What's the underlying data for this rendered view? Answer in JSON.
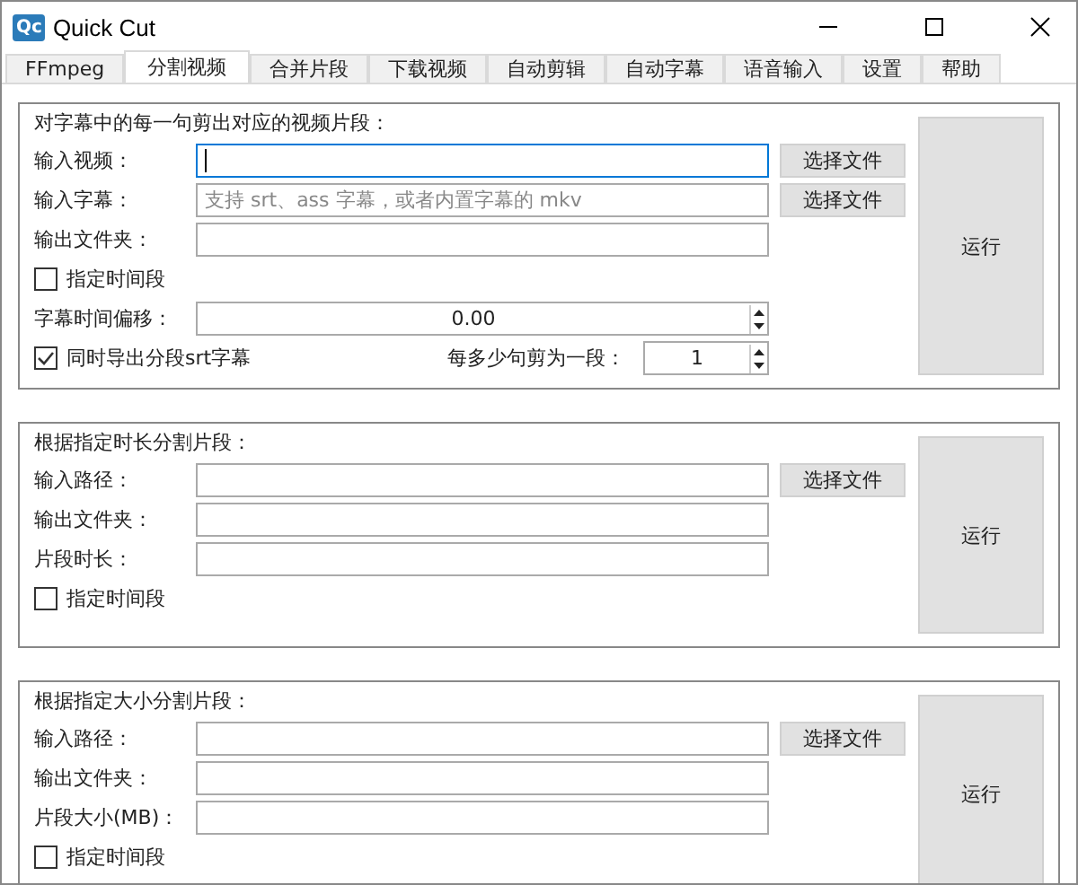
{
  "window": {
    "logo": "Qc",
    "title": "Quick Cut"
  },
  "tabs": [
    {
      "label": "FFmpeg",
      "selected": false
    },
    {
      "label": "分割视频",
      "selected": true
    },
    {
      "label": "合并片段",
      "selected": false
    },
    {
      "label": "下载视频",
      "selected": false
    },
    {
      "label": "自动剪辑",
      "selected": false
    },
    {
      "label": "自动字幕",
      "selected": false
    },
    {
      "label": "语音输入",
      "selected": false
    },
    {
      "label": "设置",
      "selected": false
    },
    {
      "label": "帮助",
      "selected": false
    }
  ],
  "sections": [
    {
      "title": "对字幕中的每一句剪出对应的视频片段：",
      "run_button": "运行",
      "rows": [
        {
          "kind": "field",
          "label": "输入视频：",
          "focused": true,
          "button": "选择文件"
        },
        {
          "kind": "field",
          "label": "输入字幕：",
          "placeholder": "支持 srt、ass 字幕，或者内置字幕的 mkv",
          "focused": false,
          "button": "选择文件"
        },
        {
          "kind": "field",
          "label": "输出文件夹：",
          "focused": false
        },
        {
          "kind": "checkbox",
          "label": "指定时间段",
          "checked": false
        },
        {
          "kind": "spin",
          "label": "字幕时间偏移：",
          "value": "0.00"
        },
        {
          "kind": "check_spin",
          "check_label": "同时导出分段srt字幕",
          "checked": true,
          "label": "每多少句剪为一段：",
          "value": "1"
        }
      ]
    },
    {
      "title": "根据指定时长分割片段：",
      "run_button": "运行",
      "rows": [
        {
          "kind": "field",
          "label": "输入路径：",
          "focused": false,
          "button": "选择文件"
        },
        {
          "kind": "field",
          "label": "输出文件夹：",
          "focused": false
        },
        {
          "kind": "field",
          "label": "片段时长：",
          "focused": false
        },
        {
          "kind": "checkbox",
          "label": "指定时间段",
          "checked": false
        }
      ]
    },
    {
      "title": "根据指定大小分割片段：",
      "run_button": "运行",
      "rows": [
        {
          "kind": "field",
          "label": "输入路径：",
          "focused": false,
          "button": "选择文件"
        },
        {
          "kind": "field",
          "label": "输出文件夹：",
          "focused": false
        },
        {
          "kind": "field",
          "label": "片段大小(MB)：",
          "focused": false
        },
        {
          "kind": "checkbox",
          "label": "指定时间段",
          "checked": false
        }
      ]
    }
  ]
}
